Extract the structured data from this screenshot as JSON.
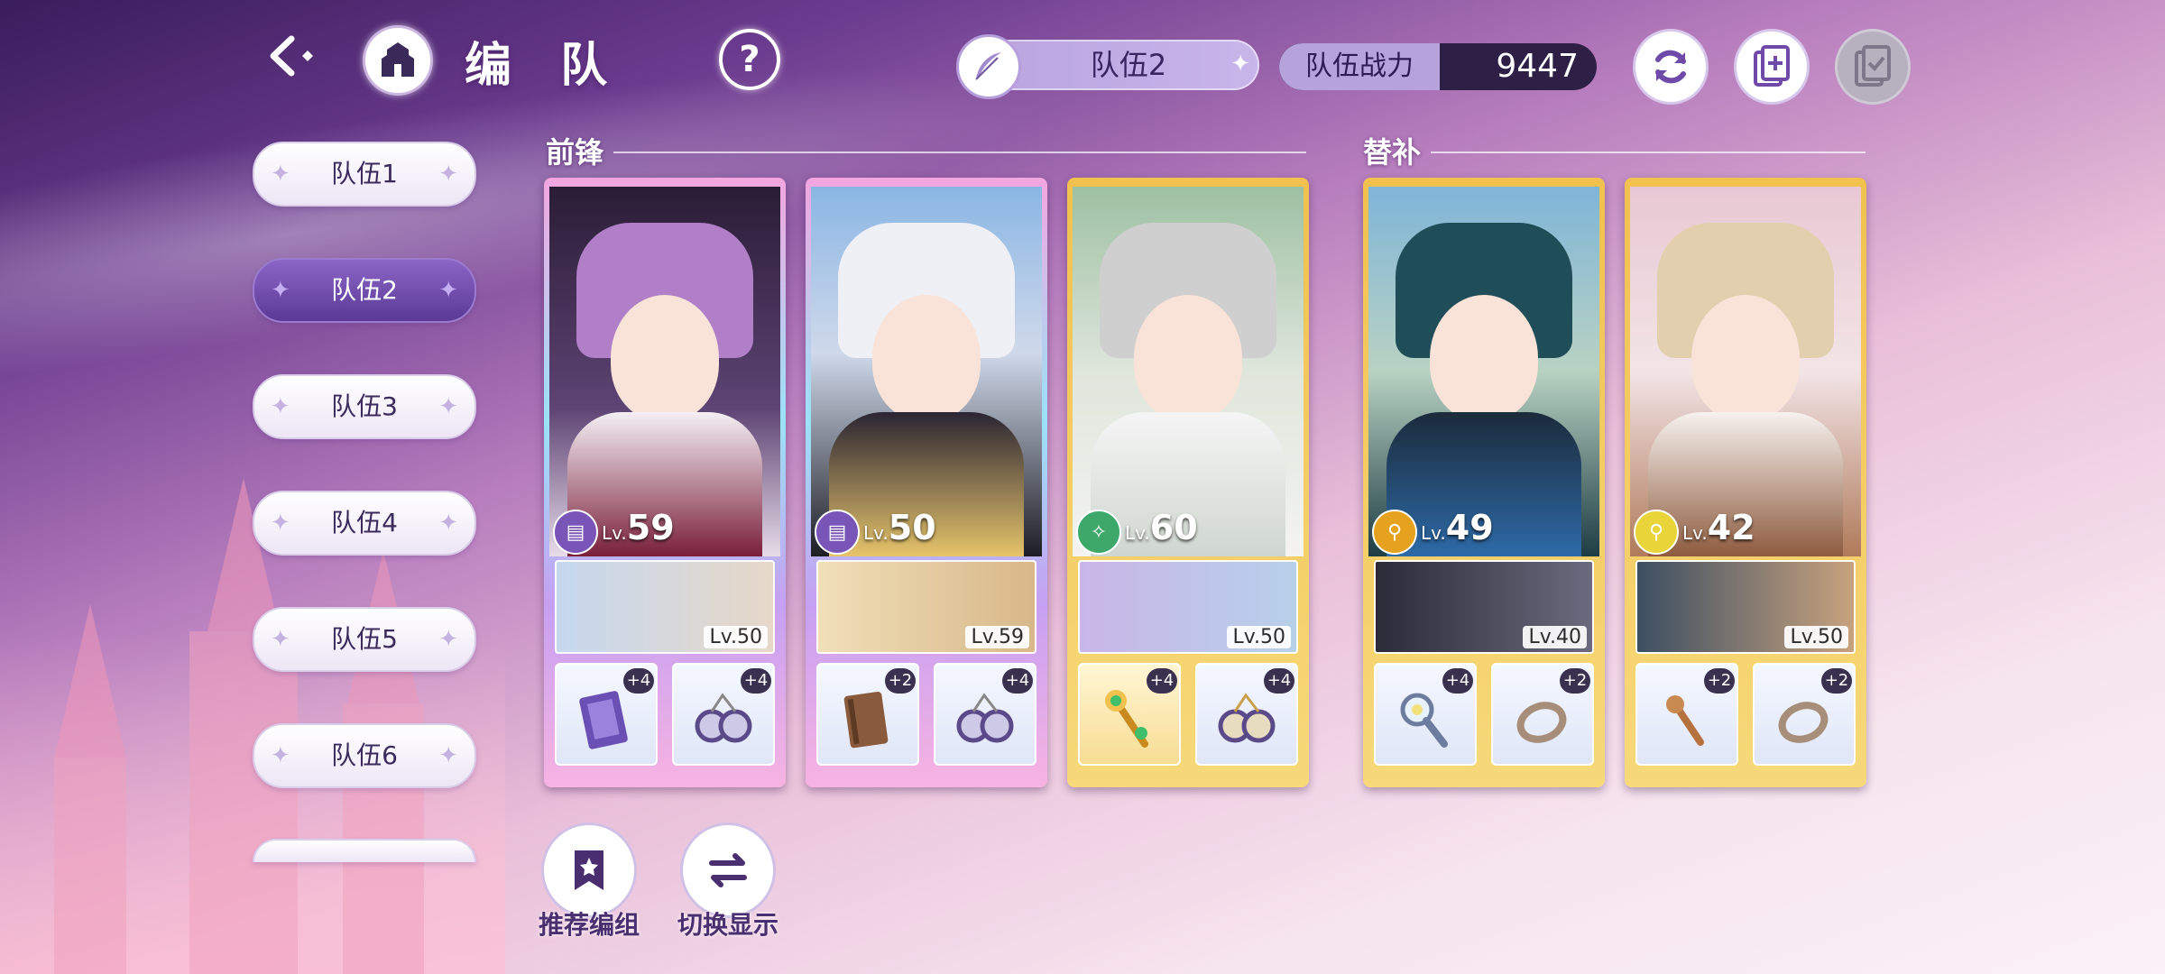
{
  "header": {
    "title": "编 队",
    "current_team": "队伍2",
    "power_label": "队伍战力",
    "power_value": "9447"
  },
  "sidebar": {
    "items": [
      {
        "label": "队伍1",
        "active": false
      },
      {
        "label": "队伍2",
        "active": true
      },
      {
        "label": "队伍3",
        "active": false
      },
      {
        "label": "队伍4",
        "active": false
      },
      {
        "label": "队伍5",
        "active": false
      },
      {
        "label": "队伍6",
        "active": false
      }
    ]
  },
  "sections": {
    "front": "前锋",
    "sub": "替补"
  },
  "cards": [
    {
      "lv_prefix": "Lv.",
      "lv": "59",
      "element": "book-element-icon",
      "frame": "rainbow",
      "support_lv": "Lv.50",
      "slot1_plus": "+4",
      "slot2_plus": "+4"
    },
    {
      "lv_prefix": "Lv.",
      "lv": "50",
      "element": "book-element-icon",
      "frame": "rainbow",
      "support_lv": "Lv.59",
      "slot1_plus": "+2",
      "slot2_plus": "+4"
    },
    {
      "lv_prefix": "Lv.",
      "lv": "60",
      "element": "wand-element-icon",
      "frame": "gold",
      "support_lv": "Lv.50",
      "slot1_plus": "+4",
      "slot2_plus": "+4"
    },
    {
      "lv_prefix": "Lv.",
      "lv": "49",
      "element": "magnifier-element-icon",
      "frame": "gold",
      "support_lv": "Lv.40",
      "slot1_plus": "+4",
      "slot2_plus": "+2"
    },
    {
      "lv_prefix": "Lv.",
      "lv": "42",
      "element": "magnifier-element-icon",
      "frame": "gold",
      "support_lv": "Lv.50",
      "slot1_plus": "+2",
      "slot2_plus": "+2"
    }
  ],
  "bottom": {
    "recommend": "推荐编组",
    "switch_view": "切换显示"
  },
  "colors": {
    "accent_purple": "#6f4aa8",
    "gold": "#f2c14e"
  }
}
